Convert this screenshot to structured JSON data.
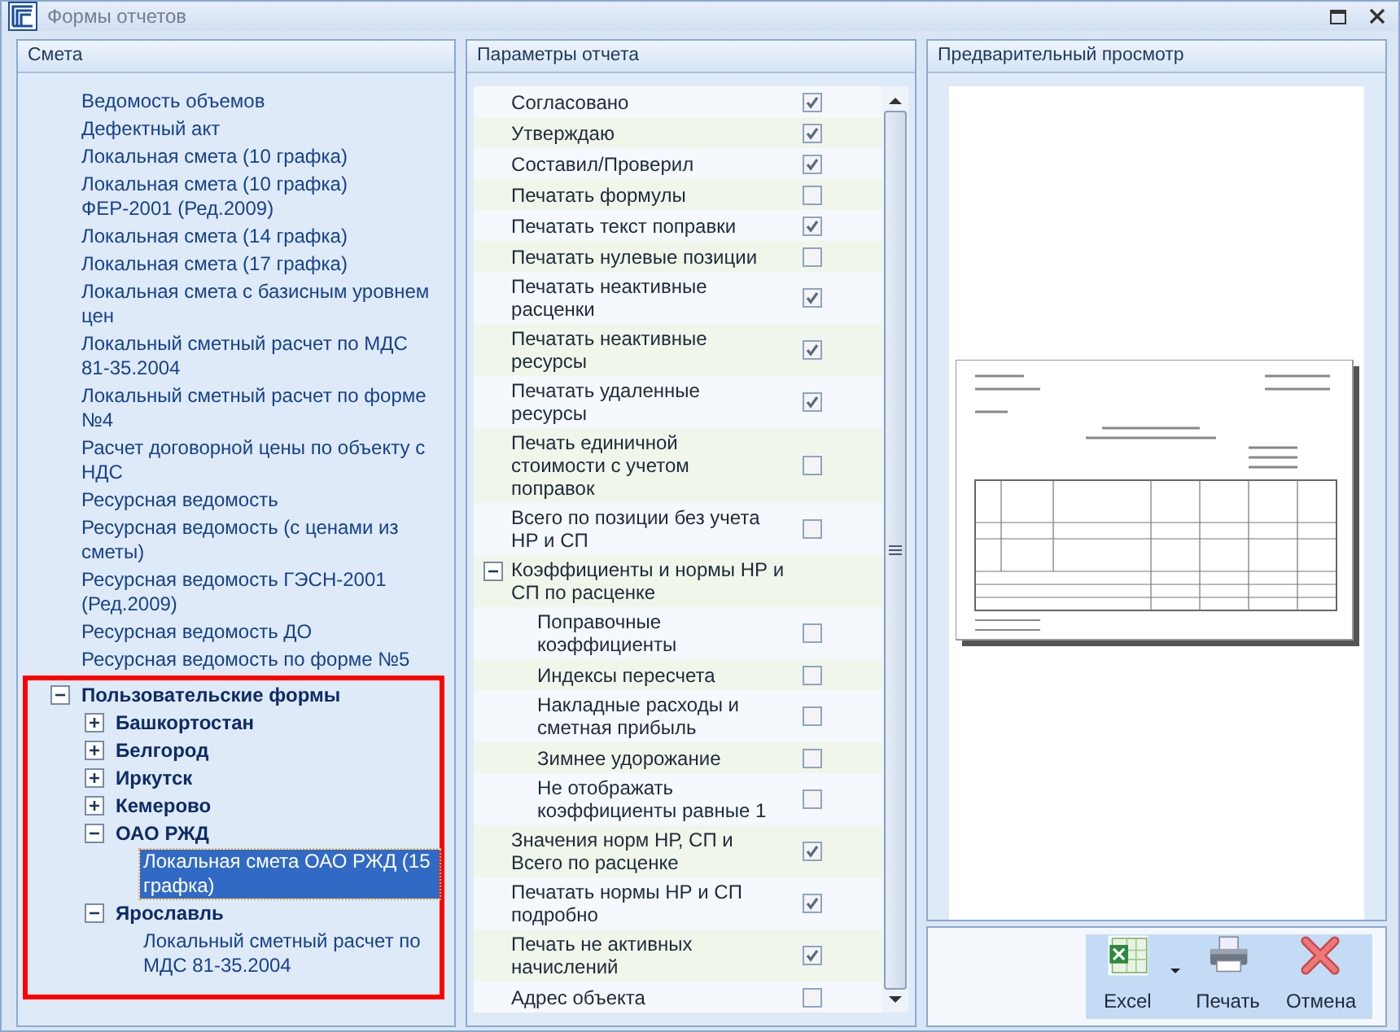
{
  "window": {
    "title": "Формы отчетов"
  },
  "estimate_panel": {
    "header": "Смета",
    "items": [
      {
        "label": "Ведомость объемов",
        "kind": "form",
        "selected": false
      },
      {
        "label": "Дефектный акт",
        "kind": "form",
        "selected": false
      },
      {
        "label": "Локальная смета (10 графка)",
        "kind": "form",
        "selected": false
      },
      {
        "label": "Локальная смета (10 графка) ФЕР-2001 (Ред.2009)",
        "kind": "form",
        "selected": false
      },
      {
        "label": "Локальная смета (14 графка)",
        "kind": "form",
        "selected": false
      },
      {
        "label": "Локальная смета (17 графка)",
        "kind": "form",
        "selected": false
      },
      {
        "label": "Локальная смета с базисным уровнем цен",
        "kind": "form",
        "selected": false
      },
      {
        "label": "Локальный сметный расчет по МДС 81-35.2004",
        "kind": "form",
        "selected": false
      },
      {
        "label": "Локальный сметный расчет по форме №4",
        "kind": "form",
        "selected": false
      },
      {
        "label": "Расчет договорной цены по объекту с НДС",
        "kind": "form",
        "selected": false
      },
      {
        "label": "Ресурсная ведомость",
        "kind": "form",
        "selected": false
      },
      {
        "label": "Ресурсная ведомость (с ценами из сметы)",
        "kind": "form",
        "selected": false
      },
      {
        "label": "Ресурсная ведомость ГЭСН-2001 (Ред.2009)",
        "kind": "form",
        "selected": false
      },
      {
        "label": "Ресурсная ведомость ДО",
        "kind": "form",
        "selected": false
      },
      {
        "label": "Ресурсная ведомость по форме №5",
        "kind": "form",
        "selected": false
      },
      {
        "label": "Пользовательские формы",
        "kind": "group",
        "selected": false,
        "expanded": true,
        "highlighted": true,
        "children": [
          {
            "label": "Башкортостан",
            "kind": "group",
            "selected": false,
            "expanded": false
          },
          {
            "label": "Белгород",
            "kind": "group",
            "selected": false,
            "expanded": false
          },
          {
            "label": "Иркутск",
            "kind": "group",
            "selected": false,
            "expanded": false
          },
          {
            "label": "Кемерово",
            "kind": "group",
            "selected": false,
            "expanded": false
          },
          {
            "label": "ОАО РЖД",
            "kind": "group",
            "selected": false,
            "expanded": true,
            "children": [
              {
                "label": "Локальная смета ОАО РЖД (15 графка)",
                "kind": "form",
                "selected": true
              }
            ]
          },
          {
            "label": "Ярославль",
            "kind": "group",
            "selected": false,
            "expanded": true,
            "children": [
              {
                "label": "Локальный сметный расчет по МДС 81-35.2004",
                "kind": "form",
                "selected": false
              }
            ]
          }
        ]
      }
    ]
  },
  "parameters_panel": {
    "header": "Параметры отчета",
    "items": [
      {
        "label": "Согласовано",
        "kind": "option",
        "checked": true
      },
      {
        "label": "Утверждаю",
        "kind": "option",
        "checked": true
      },
      {
        "label": "Составил/Проверил",
        "kind": "option",
        "checked": true
      },
      {
        "label": "Печатать формулы",
        "kind": "option",
        "checked": false
      },
      {
        "label": "Печатать текст поправки",
        "kind": "option",
        "checked": true
      },
      {
        "label": "Печатать нулевые позиции",
        "kind": "option",
        "checked": false
      },
      {
        "label": "Печатать неактивные расценки",
        "kind": "option",
        "checked": true
      },
      {
        "label": "Печатать неактивные ресурсы",
        "kind": "option",
        "checked": true
      },
      {
        "label": "Печатать удаленные ресурсы",
        "kind": "option",
        "checked": true
      },
      {
        "label": "Печать единичной стоимости с учетом поправок",
        "kind": "option",
        "checked": false
      },
      {
        "label": "Всего по позиции без учета НР и СП",
        "kind": "option",
        "checked": false
      },
      {
        "label": "Коэффициенты и нормы НР и СП по расценке",
        "kind": "group",
        "expanded": true,
        "children": [
          {
            "label": "Поправочные коэффициенты",
            "kind": "option",
            "checked": false
          },
          {
            "label": "Индексы пересчета",
            "kind": "option",
            "checked": false
          },
          {
            "label": "Накладные расходы и сметная прибыль",
            "kind": "option",
            "checked": false
          },
          {
            "label": "Зимнее удорожание",
            "kind": "option",
            "checked": false
          },
          {
            "label": "Не отображать коэффициенты равные 1",
            "kind": "option",
            "checked": false
          }
        ]
      },
      {
        "label": "Значения норм НР, СП и Всего по расценке",
        "kind": "option",
        "checked": true
      },
      {
        "label": "Печатать нормы НР и СП подробно",
        "kind": "option",
        "checked": true
      },
      {
        "label": "Печать не активных начислений",
        "kind": "option",
        "checked": true
      },
      {
        "label": "Адрес объекта",
        "kind": "option",
        "checked": false
      }
    ]
  },
  "preview_panel": {
    "header": "Предварительный просмотр"
  },
  "toolbar": {
    "buttons": [
      {
        "label": "Excel",
        "kind": "excel",
        "dropdown": true
      },
      {
        "label": "Печать",
        "kind": "print",
        "dropdown": false
      },
      {
        "label": "Отмена",
        "kind": "cancel",
        "dropdown": false
      }
    ]
  }
}
